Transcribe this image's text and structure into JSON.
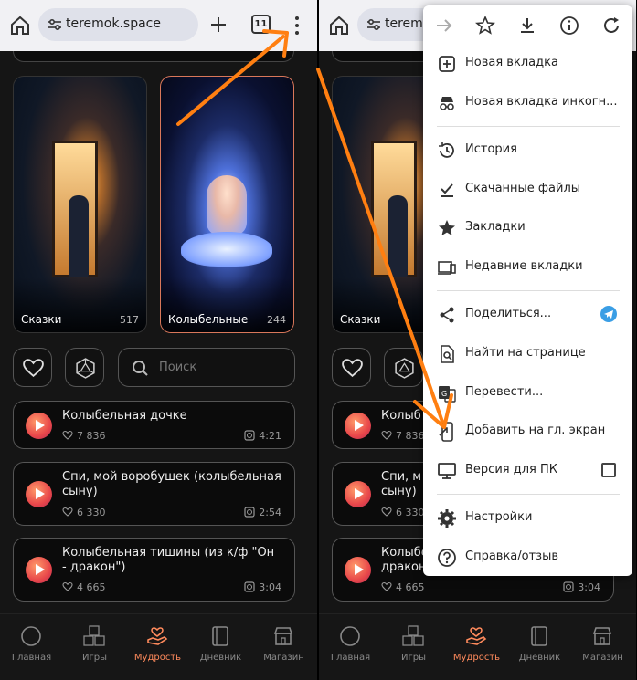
{
  "browser": {
    "url": "teremok.space",
    "url_right": "teremo",
    "tab_count": "11"
  },
  "categories": [
    {
      "name": "Сказки",
      "count": "517"
    },
    {
      "name": "Колыбельные",
      "count": "244"
    }
  ],
  "search": {
    "placeholder": "Поиск"
  },
  "tracks": [
    {
      "title": "Колыбельная дочке",
      "title_right": "Колыб",
      "likes": "7 836",
      "duration": "4:21"
    },
    {
      "title": "Спи, мой воробушек (колыбельная сыну)",
      "title_right": "Спи, м",
      "title_right_2": "сыну)",
      "likes": "6 330",
      "duration": "2:54"
    },
    {
      "title": "Колыбельная тишины (из к/ф \"Он - дракон\")",
      "title_right": "Колыбе",
      "title_right_2": "дракон",
      "likes": "4 665",
      "duration": "3:04"
    }
  ],
  "nav": [
    {
      "label": "Главная"
    },
    {
      "label": "Игры"
    },
    {
      "label": "Мудрость"
    },
    {
      "label": "Дневник"
    },
    {
      "label": "Магазин"
    }
  ],
  "menu": {
    "items": [
      {
        "label": "Новая вкладка",
        "icon": "new-tab-icon"
      },
      {
        "label": "Новая вкладка инкогн...",
        "icon": "incognito-icon"
      },
      {
        "label": "История",
        "icon": "history-icon"
      },
      {
        "label": "Скачанные файлы",
        "icon": "downloads-icon"
      },
      {
        "label": "Закладки",
        "icon": "bookmarks-icon"
      },
      {
        "label": "Недавние вкладки",
        "icon": "recent-tabs-icon"
      },
      {
        "label": "Поделиться...",
        "icon": "share-icon"
      },
      {
        "label": "Найти на странице",
        "icon": "find-icon"
      },
      {
        "label": "Перевести...",
        "icon": "translate-icon"
      },
      {
        "label": "Добавить на гл. экран",
        "icon": "add-home-icon"
      },
      {
        "label": "Версия для ПК",
        "icon": "desktop-icon"
      },
      {
        "label": "Настройки",
        "icon": "settings-icon"
      },
      {
        "label": "Справка/отзыв",
        "icon": "help-icon"
      }
    ]
  },
  "colors": {
    "accent": "#ff8a5c",
    "arrow": "#ff7f11",
    "telegram": "#3a9ee5"
  }
}
